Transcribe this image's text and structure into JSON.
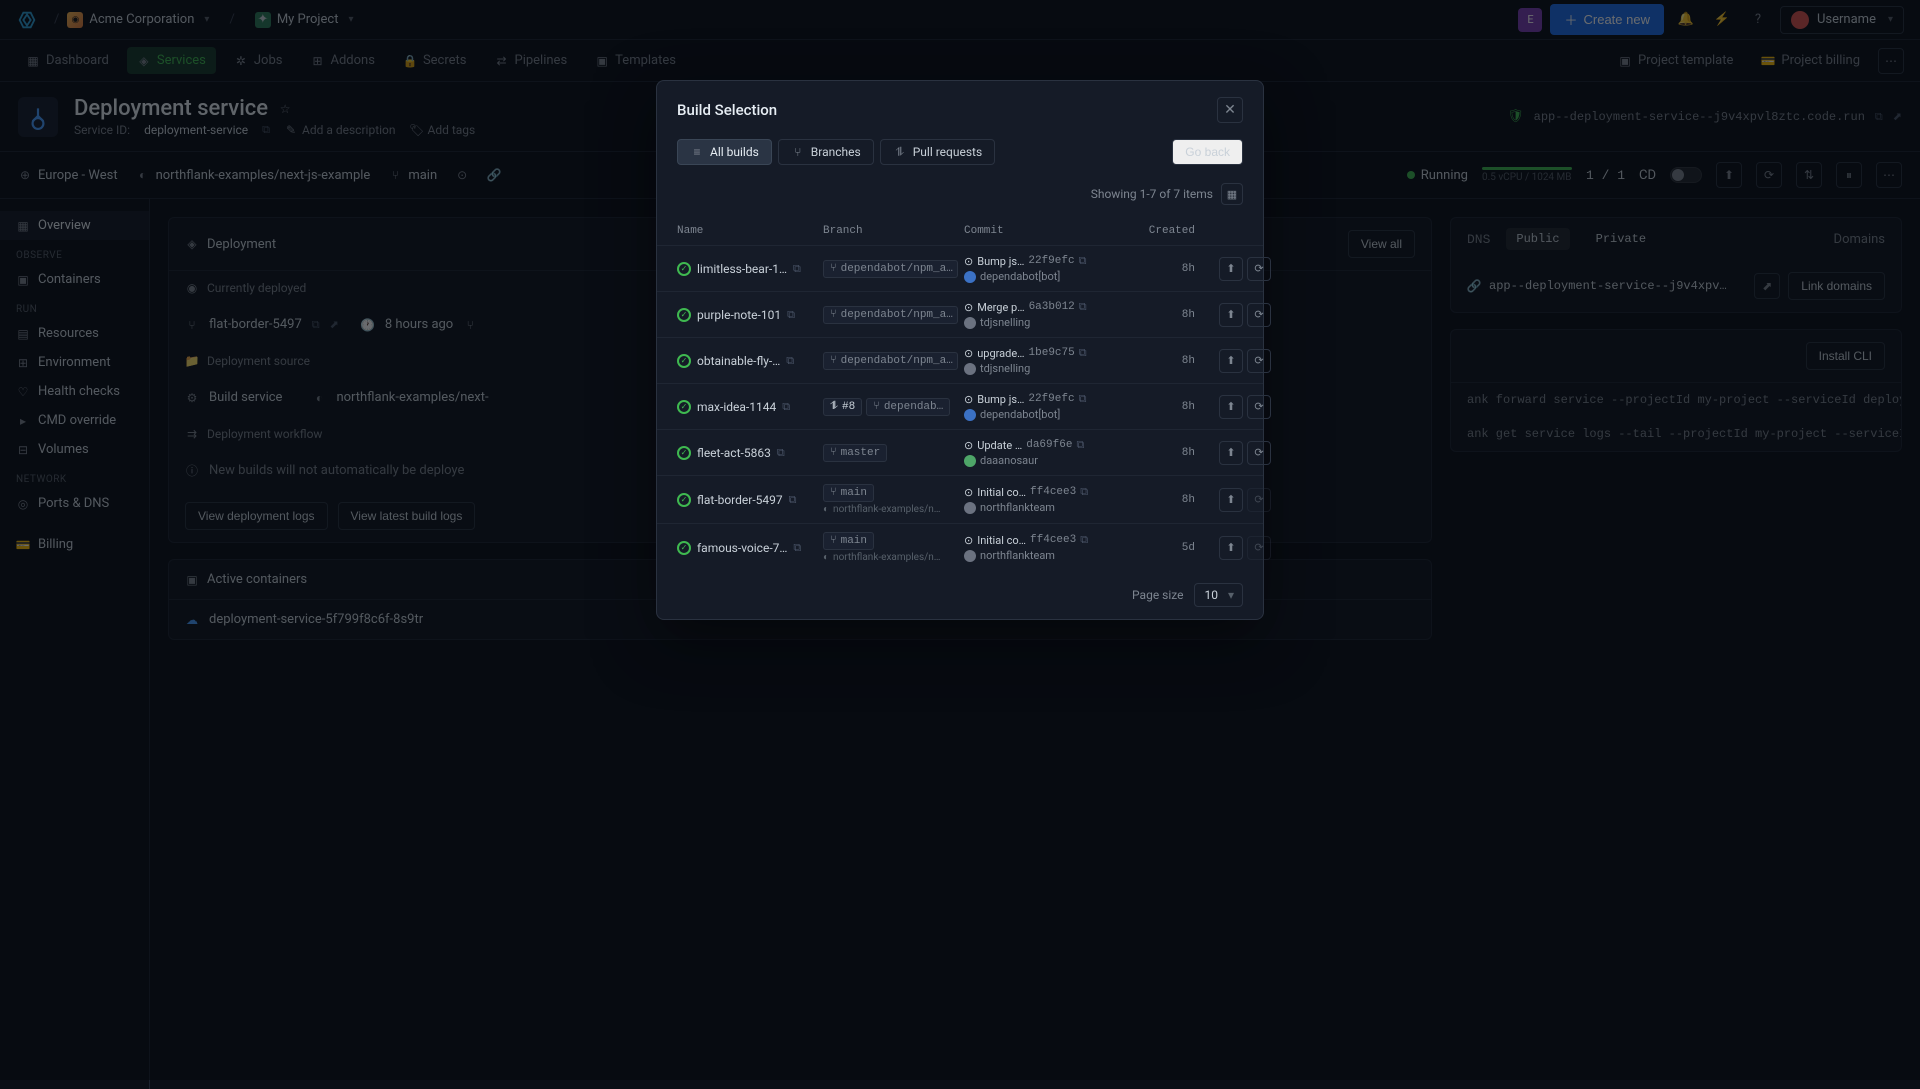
{
  "topbar": {
    "org": "Acme Corporation",
    "project": "My Project",
    "create_btn": "Create new",
    "username": "Username",
    "user_initial": "E"
  },
  "nav": {
    "items": [
      "Dashboard",
      "Services",
      "Jobs",
      "Addons",
      "Secrets",
      "Pipelines",
      "Templates"
    ],
    "right": [
      "Project template",
      "Project billing"
    ]
  },
  "header": {
    "title": "Deployment service",
    "service_id_label": "Service ID:",
    "service_id": "deployment-service",
    "desc_placeholder": "Add a description",
    "tags_placeholder": "Add tags",
    "url": "app--deployment-service--j9v4xpvl8ztc.code.run"
  },
  "context": {
    "region": "Europe - West",
    "repo": "northflank-examples/next-js-example",
    "branch": "main",
    "status": "Running",
    "resources": "0.5 vCPU / 1024 MB",
    "instances": "1 / 1",
    "cd_label": "CD"
  },
  "sidebar": {
    "overview": "Overview",
    "observe_label": "OBSERVE",
    "containers": "Containers",
    "run_label": "RUN",
    "run_items": [
      "Resources",
      "Environment",
      "Health checks",
      "CMD override",
      "Volumes"
    ],
    "network_label": "NETWORK",
    "ports": "Ports & DNS",
    "billing": "Billing"
  },
  "deployment": {
    "title": "Deployment",
    "currently": "Currently deployed",
    "build_name": "flat-border-5497",
    "build_time": "8 hours ago",
    "source_label": "Deployment source",
    "source_service": "Build service",
    "source_repo": "northflank-examples/next-",
    "workflow_label": "Deployment workflow",
    "workflow_msg": "New builds will not automatically be deploye",
    "btn_logs": "View deployment logs",
    "btn_build_logs": "View latest build logs",
    "active_title": "Active containers",
    "container_name": "deployment-service-5f799f8c6f-8s9tr",
    "view_all": "View all"
  },
  "dns": {
    "label": "DNS",
    "public": "Public",
    "private": "Private",
    "domains_label": "Domains",
    "domain": "app--deployment-service--j9v4xpv…",
    "link_btn": "Link domains",
    "cli_btn": "Install CLI",
    "cli1": "ank forward service --projectId my-project --serviceId deployment-serv",
    "cli2": "ank get service logs --tail --projectId my-project --serviceId deploym"
  },
  "modal": {
    "title": "Build Selection",
    "tab_all": "All builds",
    "tab_branches": "Branches",
    "tab_pr": "Pull requests",
    "go_back": "Go back",
    "showing": "Showing 1-7 of 7 items",
    "cols": {
      "name": "Name",
      "branch": "Branch",
      "commit": "Commit",
      "created": "Created"
    },
    "page_size_label": "Page size",
    "page_size": "10",
    "rows": [
      {
        "name": "limitless-bear-1…",
        "branch": "dependabot/npm_a…",
        "pr": null,
        "commit_msg": "Bump js…",
        "hash": "22f9efc",
        "author": "dependabot[bot]",
        "author_c": "blue",
        "created": "8h",
        "restart": true
      },
      {
        "name": "purple-note-101",
        "branch": "dependabot/npm_a…",
        "pr": null,
        "commit_msg": "Merge p…",
        "hash": "6a3b012",
        "author": "tdjsnelling",
        "author_c": "grey",
        "created": "8h",
        "restart": true
      },
      {
        "name": "obtainable-fly-…",
        "branch": "dependabot/npm_a…",
        "pr": null,
        "commit_msg": "upgrade…",
        "hash": "1be9c75",
        "author": "tdjsnelling",
        "author_c": "grey",
        "created": "8h",
        "restart": true
      },
      {
        "name": "max-idea-1144",
        "branch": "dependab…",
        "pr": "#8",
        "commit_msg": "Bump js…",
        "hash": "22f9efc",
        "author": "dependabot[bot]",
        "author_c": "blue",
        "created": "8h",
        "restart": true
      },
      {
        "name": "fleet-act-5863",
        "branch": "master",
        "pr": null,
        "commit_msg": "Update …",
        "hash": "da69f6e",
        "author": "daaanosaur",
        "author_c": "green",
        "created": "8h",
        "restart": true
      },
      {
        "name": "flat-border-5497",
        "branch": "main",
        "branch_sub": "northflank-examples/n…",
        "pr": null,
        "commit_msg": "Initial co…",
        "hash": "ff4cee3",
        "author": "northflankteam",
        "author_c": "grey",
        "created": "8h",
        "restart": false
      },
      {
        "name": "famous-voice-7…",
        "branch": "main",
        "branch_sub": "northflank-examples/n…",
        "pr": null,
        "commit_msg": "Initial co…",
        "hash": "ff4cee3",
        "author": "northflankteam",
        "author_c": "grey",
        "created": "5d",
        "restart": false
      }
    ]
  }
}
